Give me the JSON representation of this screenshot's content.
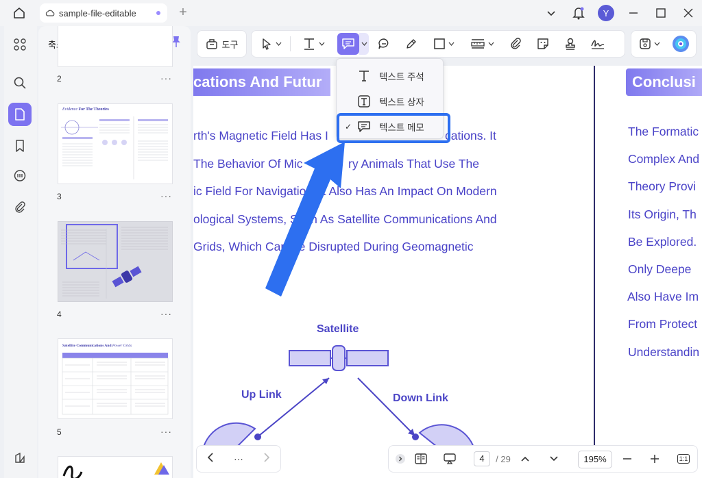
{
  "titlebar": {
    "tab_title": "sample-file-editable",
    "avatar_initial": "Y"
  },
  "panel": {
    "title": "축소판",
    "pages": [
      "2",
      "3",
      "4",
      "5"
    ],
    "more": "···",
    "thumb3_title_a": "Evidence ",
    "thumb3_title_b": "For The Theories",
    "thumb5_title_a": "Satellite Communications And ",
    "thumb5_title_b": "Power Grids"
  },
  "toolbar": {
    "tools_label": "도구"
  },
  "dropdown": {
    "items": [
      {
        "label": "텍스트 주석"
      },
      {
        "label": "텍스트 상자"
      },
      {
        "label": "텍스트 메모",
        "checked": true
      }
    ],
    "check": "✓"
  },
  "doc": {
    "heading_left": "cations And Futur",
    "heading_right": "Conclusi",
    "left_lines": [
      "rth's Magnetic Field Has I",
      "cations. It",
      "The Behavior Of Mic",
      "ry Animals That Use The",
      "ic Field For Navigation. It Also Has An Impact On Modern",
      "ological Systems, Such As Satellite Communications And",
      "Grids, Which Can Be Disrupted During Geomagnetic"
    ],
    "right_lines": [
      "The Formatic",
      "Complex And",
      "Theory Provi",
      "Its Origin, Th",
      "Be Explored.",
      "Only Deepe",
      "Also Have Im",
      "From Protect",
      "Understandin"
    ],
    "diagram": {
      "satellite": "Satellite",
      "uplink": "Up Link",
      "downlink": "Down Link"
    }
  },
  "bottom": {
    "ellipsis": "···",
    "current_page": "4",
    "total_pages": "/ 29",
    "zoom": "195%",
    "fit": "1:1"
  },
  "colors": {
    "accent": "#7d73f0",
    "doc_text": "#4a43c8",
    "highlight": "#2d6ff0"
  }
}
